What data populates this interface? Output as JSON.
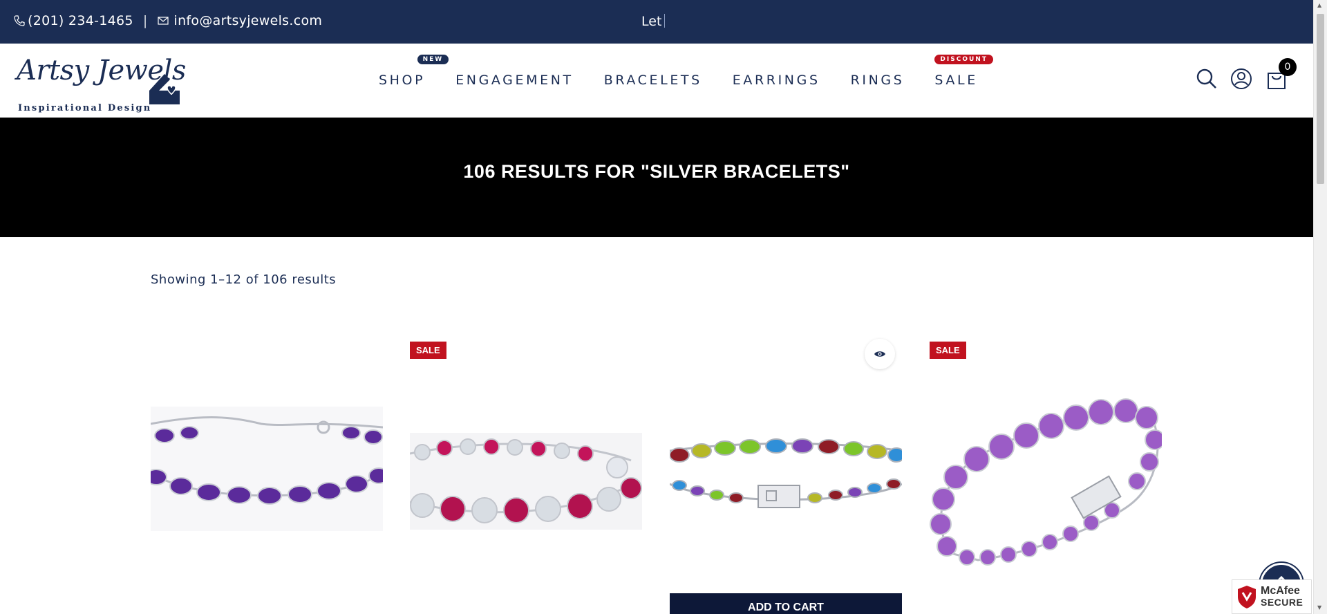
{
  "topbar": {
    "phone": "(201) 234-1465",
    "separator": "|",
    "email": "info@artsyjewels.com",
    "typed_text": "Let"
  },
  "logo": {
    "name": "Artsy Jewels",
    "tagline": "Inspirational Design"
  },
  "nav": {
    "items": [
      {
        "label": "SHOP",
        "badge": "NEW"
      },
      {
        "label": "ENGAGEMENT",
        "badge": ""
      },
      {
        "label": "BRACELETS",
        "badge": ""
      },
      {
        "label": "EARRINGS",
        "badge": ""
      },
      {
        "label": "RINGS",
        "badge": ""
      },
      {
        "label": "SALE",
        "badge": "DISCOUNT"
      }
    ]
  },
  "header_icons": {
    "search": "search-icon",
    "account": "user-icon",
    "cart": "shopping-bag-icon",
    "cart_count": "0"
  },
  "banner": {
    "title": "106 RESULTS FOR \"SILVER BRACELETS\""
  },
  "results": {
    "showing": "Showing 1–12 of 106 results"
  },
  "products": [
    {
      "sale_badge": "",
      "gem": "amethyst tennis bracelet"
    },
    {
      "sale_badge": "SALE",
      "gem": "ruby and white topaz bracelet"
    },
    {
      "sale_badge": "",
      "gem": "multi-gemstone bracelet",
      "add_to_cart": "ADD TO CART"
    },
    {
      "sale_badge": "SALE",
      "gem": "amethyst round-cut bracelet"
    }
  ],
  "colors": {
    "navy": "#1b2d54",
    "sale_red": "#c1121f",
    "banner_black": "#000000"
  },
  "trust_badge": {
    "line1": "McAfee",
    "line2": "SECURE"
  }
}
